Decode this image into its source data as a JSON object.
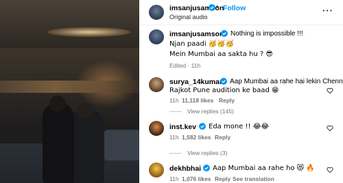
{
  "post": {
    "author": "imsanjusamson",
    "follow_label": "Follow",
    "separator": "•",
    "subtitle": "Original audio",
    "caption_author": "imsanjusamson",
    "caption_lines": [
      "Nothing is impossible !!!",
      "Njan paadi 🥳🥳🥳",
      "Mein Mumbai aa sakta hu ? 😎"
    ],
    "caption_meta": "Edited · 11h"
  },
  "comments": [
    {
      "user": "surya_14kumar",
      "text_line1": "Aap Mumbai aa rahe hai lekin Chennai",
      "text_line2": "Rajkot Pune audition ke baad 😁",
      "time": "11h",
      "likes": "11,118 likes",
      "reply": "Reply",
      "view_replies": "View replies (145)"
    },
    {
      "user": "inst.kev",
      "text_line1": "Eda mone !! 😂😂",
      "time": "11h",
      "likes": "1,582 likes",
      "reply": "Reply",
      "view_replies": "View replies (3)"
    },
    {
      "user": "dekhbhai",
      "text_line1": "Aap Mumbai aa rahe ho 😻 🔥",
      "time": "11h",
      "likes": "1,076 likes",
      "reply": "Reply",
      "translation": "See translation"
    }
  ],
  "colors": {
    "link": "#0095f6",
    "verified": "#0095f6",
    "muted": "#737373"
  },
  "icons": [
    "verified-badge-icon",
    "more-options-icon",
    "heart-icon"
  ]
}
